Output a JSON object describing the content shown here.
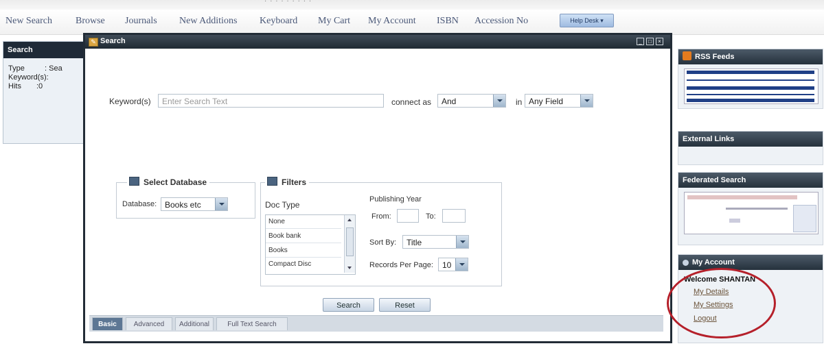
{
  "nav": {
    "items": [
      "New Search",
      "Browse",
      "Journals",
      "New Additions",
      "Keyboard",
      "My Cart",
      "My Account",
      "ISBN",
      "Accession No"
    ],
    "help_desk": "Help Desk"
  },
  "left_panel": {
    "title": "Search",
    "type_label": "Type",
    "type_value": ": Sea",
    "keywords_label": "Keyword(s):",
    "hits_label": "Hits",
    "hits_value": ":0"
  },
  "dialog": {
    "title": "Search",
    "keyword_label": "Keyword(s)",
    "keyword_placeholder": "Enter Search Text",
    "connect_label": "connect as",
    "connect_value": "And",
    "in_label": "in",
    "field_value": "Any Field",
    "select_database": {
      "legend": "Select Database",
      "label": "Database:",
      "value": "Books etc"
    },
    "filters": {
      "legend": "Filters",
      "doc_type_label": "Doc Type",
      "doc_types": [
        "None",
        "Book bank",
        "Books",
        "Compact Disc"
      ],
      "publishing_year_label": "Publishing Year",
      "from_label": "From:",
      "to_label": "To:",
      "sort_by_label": "Sort By:",
      "sort_by_value": "Title",
      "records_label": "Records Per Page:",
      "records_value": "10"
    },
    "search_button": "Search",
    "reset_button": "Reset",
    "tabs": [
      "Basic",
      "Advanced",
      "Additional",
      "Full Text Search"
    ],
    "active_tab": "Basic"
  },
  "right": {
    "rss_title": "RSS Feeds",
    "external_title": "External Links",
    "federated_title": "Federated Search",
    "account_title": "My Account",
    "welcome": "Welcome SHANTAN",
    "links": [
      "My Details",
      "My Settings",
      "Logout"
    ]
  },
  "colors": {
    "header_dark": "#25313c",
    "nav_text": "#4a5878",
    "annotation_red": "#b5202a",
    "active_tab": "#5d7794"
  }
}
